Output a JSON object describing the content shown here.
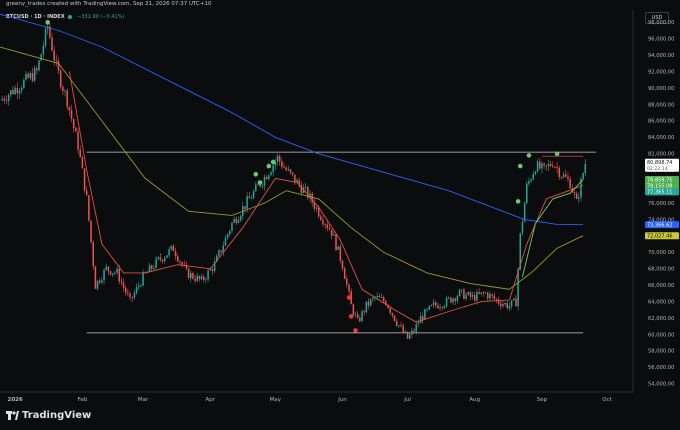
{
  "header": {
    "credit": "greeny_trades created with TradingView.com, Sep 21, 2026 07:37 UTC+10",
    "symbol": "BTCUSD · 1D · INDEX",
    "change": "−331.90 (−0.41%)",
    "currency": "USD"
  },
  "brand": {
    "name": "TradingView"
  },
  "colors": {
    "up": "#26a69a",
    "down": "#ef5350",
    "ma_blue": "#2962ff",
    "ma_olive": "#9a9a2c",
    "ma_red": "#e0543a",
    "ma_green": "#6ec96e",
    "background": "#0b0c0e"
  },
  "chart_data": {
    "type": "candlestick",
    "y_ticks": [
      "54,000.00",
      "56,000.00",
      "58,000.00",
      "60,000.00",
      "62,000.00",
      "64,000.00",
      "66,000.00",
      "68,000.00",
      "70,000.00",
      "72,000.00",
      "74,000.00",
      "76,000.00",
      "78,000.00",
      "80,000.00",
      "82,000.00",
      "84,000.00",
      "86,000.00",
      "88,000.00",
      "90,000.00",
      "92,000.00",
      "94,000.00",
      "96,000.00",
      "98,000.00"
    ],
    "y_range": [
      53000,
      99500
    ],
    "x_ticks": [
      {
        "label": "2026",
        "day": 0
      },
      {
        "label": "Feb",
        "day": 31
      },
      {
        "label": "Mar",
        "day": 59
      },
      {
        "label": "Apr",
        "day": 90
      },
      {
        "label": "May",
        "day": 120
      },
      {
        "label": "Jun",
        "day": 151
      },
      {
        "label": "Jul",
        "day": 181
      },
      {
        "label": "Aug",
        "day": 212
      },
      {
        "label": "Sep",
        "day": 243
      },
      {
        "label": "Oct",
        "day": 273
      }
    ],
    "x_range_days": [
      -7,
      285
    ],
    "horizontal_lines": [
      82200,
      60200
    ],
    "price_labels": [
      {
        "text": "80,898.74",
        "sub": "02:22:14",
        "value": 80899,
        "bg": "#ffffff",
        "fg": "#111111"
      },
      {
        "text": "78,859.75",
        "value": 78860,
        "bg": "#4caf50",
        "fg": "#ffffff"
      },
      {
        "text": "78,155.08",
        "value": 78155,
        "bg": "#4caf50",
        "fg": "#ffffff"
      },
      {
        "text": "77,365.11",
        "value": 77365,
        "bg": "#26a69a",
        "fg": "#ffffff"
      },
      {
        "text": "73,366.62",
        "value": 73367,
        "bg": "#2962ff",
        "fg": "#ffffff"
      },
      {
        "text": "72,027.46",
        "value": 72027,
        "bg": "#c8c83a",
        "fg": "#111111"
      }
    ],
    "key_closes": [
      {
        "day": -7,
        "close": 88500
      },
      {
        "day": 3,
        "close": 90500
      },
      {
        "day": 10,
        "close": 92000
      },
      {
        "day": 15,
        "close": 97500
      },
      {
        "day": 19,
        "close": 92500
      },
      {
        "day": 24,
        "close": 88500
      },
      {
        "day": 29,
        "close": 83000
      },
      {
        "day": 33,
        "close": 76500
      },
      {
        "day": 37,
        "close": 66000
      },
      {
        "day": 42,
        "close": 68000
      },
      {
        "day": 47,
        "close": 67500
      },
      {
        "day": 53,
        "close": 64000
      },
      {
        "day": 59,
        "close": 67000
      },
      {
        "day": 66,
        "close": 69000
      },
      {
        "day": 73,
        "close": 70500
      },
      {
        "day": 79,
        "close": 67500
      },
      {
        "day": 86,
        "close": 66500
      },
      {
        "day": 92,
        "close": 68500
      },
      {
        "day": 100,
        "close": 73500
      },
      {
        "day": 108,
        "close": 76500
      },
      {
        "day": 116,
        "close": 79500
      },
      {
        "day": 121,
        "close": 81500
      },
      {
        "day": 125,
        "close": 80000
      },
      {
        "day": 130,
        "close": 78500
      },
      {
        "day": 135,
        "close": 77000
      },
      {
        "day": 141,
        "close": 74500
      },
      {
        "day": 146,
        "close": 72500
      },
      {
        "day": 151,
        "close": 68500
      },
      {
        "day": 155,
        "close": 63500
      },
      {
        "day": 158,
        "close": 61500
      },
      {
        "day": 162,
        "close": 63500
      },
      {
        "day": 166,
        "close": 64500
      },
      {
        "day": 171,
        "close": 64000
      },
      {
        "day": 176,
        "close": 61500
      },
      {
        "day": 181,
        "close": 59500
      },
      {
        "day": 184,
        "close": 60500
      },
      {
        "day": 187,
        "close": 62000
      },
      {
        "day": 193,
        "close": 63500
      },
      {
        "day": 199,
        "close": 64000
      },
      {
        "day": 205,
        "close": 65000
      },
      {
        "day": 211,
        "close": 64500
      },
      {
        "day": 217,
        "close": 65000
      },
      {
        "day": 223,
        "close": 64000
      },
      {
        "day": 228,
        "close": 63500
      },
      {
        "day": 231,
        "close": 64000
      },
      {
        "day": 233,
        "close": 72000
      },
      {
        "day": 236,
        "close": 78000
      },
      {
        "day": 240,
        "close": 80500
      },
      {
        "day": 244,
        "close": 80000
      },
      {
        "day": 248,
        "close": 81000
      },
      {
        "day": 252,
        "close": 79500
      },
      {
        "day": 256,
        "close": 78500
      },
      {
        "day": 259,
        "close": 76000
      },
      {
        "day": 261,
        "close": 78500
      },
      {
        "day": 263,
        "close": 80899
      }
    ],
    "moving_averages": [
      {
        "color": "#2962ff",
        "points": [
          [
            -7,
            99000
          ],
          [
            20,
            97000
          ],
          [
            40,
            95000
          ],
          [
            70,
            91000
          ],
          [
            100,
            87000
          ],
          [
            120,
            84000
          ],
          [
            140,
            82000
          ],
          [
            160,
            80500
          ],
          [
            180,
            79000
          ],
          [
            200,
            77500
          ],
          [
            220,
            75500
          ],
          [
            235,
            74000
          ],
          [
            250,
            73400
          ],
          [
            262,
            73367
          ]
        ]
      },
      {
        "color": "#9a9a2c",
        "points": [
          [
            -7,
            95000
          ],
          [
            20,
            93000
          ],
          [
            40,
            86000
          ],
          [
            60,
            79000
          ],
          [
            80,
            75000
          ],
          [
            100,
            74500
          ],
          [
            115,
            76000
          ],
          [
            125,
            77500
          ],
          [
            140,
            76500
          ],
          [
            155,
            73000
          ],
          [
            170,
            70000
          ],
          [
            190,
            67500
          ],
          [
            210,
            66200
          ],
          [
            228,
            65500
          ],
          [
            238,
            67500
          ],
          [
            250,
            70500
          ],
          [
            262,
            72027
          ]
        ]
      },
      {
        "color": "#e0543a",
        "points": [
          [
            25,
            92000
          ],
          [
            33,
            80000
          ],
          [
            40,
            71000
          ],
          [
            50,
            67500
          ],
          [
            60,
            67500
          ],
          [
            75,
            68500
          ],
          [
            90,
            68000
          ],
          [
            105,
            73000
          ],
          [
            120,
            79000
          ],
          [
            130,
            78500
          ],
          [
            140,
            75500
          ],
          [
            150,
            71500
          ],
          [
            160,
            65500
          ],
          [
            175,
            63000
          ],
          [
            185,
            61500
          ],
          [
            200,
            62800
          ],
          [
            215,
            64000
          ],
          [
            228,
            64200
          ],
          [
            236,
            71000
          ],
          [
            245,
            76500
          ],
          [
            262,
            78155
          ]
        ]
      },
      {
        "color": "#6ec96e",
        "points": [
          [
            234,
            67000
          ],
          [
            240,
            73500
          ],
          [
            248,
            76500
          ],
          [
            256,
            77200
          ],
          [
            262,
            78860
          ]
        ]
      }
    ],
    "signal_dots": [
      {
        "day": 15,
        "value": 98000,
        "color": "#6ec96e"
      },
      {
        "day": 111,
        "value": 79500,
        "color": "#6ec96e"
      },
      {
        "day": 113,
        "value": 78500,
        "color": "#6ec96e"
      },
      {
        "day": 117,
        "value": 80500,
        "color": "#6ec96e"
      },
      {
        "day": 119,
        "value": 81000,
        "color": "#6ec96e"
      },
      {
        "day": 154,
        "value": 64500,
        "color": "#e53935"
      },
      {
        "day": 155,
        "value": 62200,
        "color": "#e53935"
      },
      {
        "day": 157,
        "value": 60500,
        "color": "#e53935"
      },
      {
        "day": 232,
        "value": 76200,
        "color": "#6ec96e"
      },
      {
        "day": 233,
        "value": 80500,
        "color": "#6ec96e"
      },
      {
        "day": 237,
        "value": 81800,
        "color": "#6ec96e"
      },
      {
        "day": 250,
        "value": 82000,
        "color": "#6ec96e"
      }
    ]
  }
}
